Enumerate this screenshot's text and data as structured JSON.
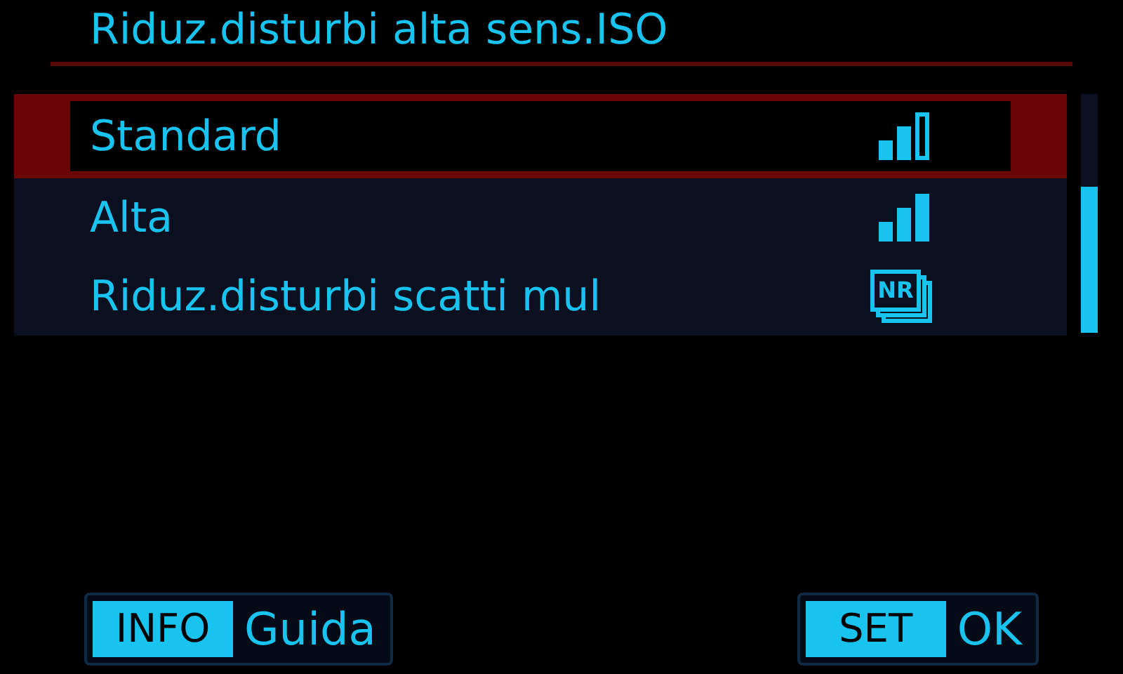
{
  "title": "Riduz.disturbi alta sens.ISO",
  "items": [
    {
      "label": "Standard",
      "selected": true,
      "kind": "medium"
    },
    {
      "label": "Alta",
      "selected": false,
      "kind": "high"
    },
    {
      "label": "Riduz.disturbi scatti mul",
      "selected": false,
      "kind": "multishot",
      "icon_text": "NR"
    }
  ],
  "footer": [
    {
      "key": "INFO",
      "label": "Guida"
    },
    {
      "key": "SET",
      "label": "OK"
    }
  ]
}
